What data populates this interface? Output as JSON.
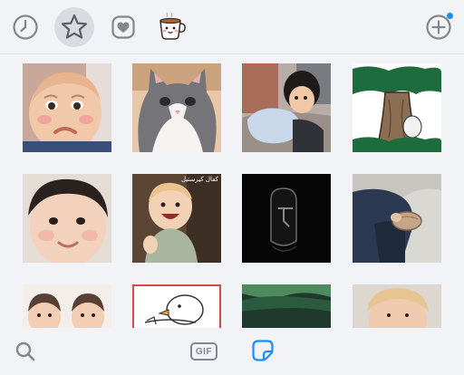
{
  "toolbar": {
    "tabs": [
      {
        "name": "recent-tab",
        "icon": "clock-icon",
        "selected": false
      },
      {
        "name": "favorites-tab",
        "icon": "star-icon",
        "selected": true
      },
      {
        "name": "hearts-tab",
        "icon": "heart-icon",
        "selected": false
      },
      {
        "name": "sticker-pack-tab",
        "icon": "coffee-cup-sticker-icon",
        "selected": false
      }
    ],
    "add_button": {
      "icon": "plus-circle-icon",
      "notification_dot": true
    }
  },
  "stickers": [
    {
      "name": "sticker-pouting-baby",
      "icon": "pouting-baby-image"
    },
    {
      "name": "sticker-cat",
      "icon": "gray-white-cat-image"
    },
    {
      "name": "sticker-toddler-on-pillow",
      "icon": "toddler-lying-image"
    },
    {
      "name": "sticker-tree-cartoon",
      "icon": "cartoon-tree-image"
    },
    {
      "name": "sticker-smiling-baby",
      "icon": "smiling-baby-image"
    },
    {
      "name": "sticker-laughing-baby",
      "icon": "laughing-baby-image",
      "caption": "كفال كيرستيل"
    },
    {
      "name": "sticker-dark-figure",
      "icon": "dark-shape-image"
    },
    {
      "name": "sticker-hands-bag",
      "icon": "person-holding-bag-image"
    },
    {
      "name": "sticker-two-babies",
      "icon": "two-babies-image"
    },
    {
      "name": "sticker-cartoon-duck",
      "icon": "cartoon-duck-image"
    },
    {
      "name": "sticker-green-scene",
      "icon": "green-scene-image"
    },
    {
      "name": "sticker-blonde-child",
      "icon": "blonde-child-image"
    }
  ],
  "bottom_bar": {
    "search_icon": "search-icon",
    "gif_label": "GIF",
    "sticker_icon": "sticker-icon"
  },
  "colors": {
    "accent": "#1a8cff",
    "icon_gray": "#85868b",
    "background": "#f2f3f6"
  }
}
